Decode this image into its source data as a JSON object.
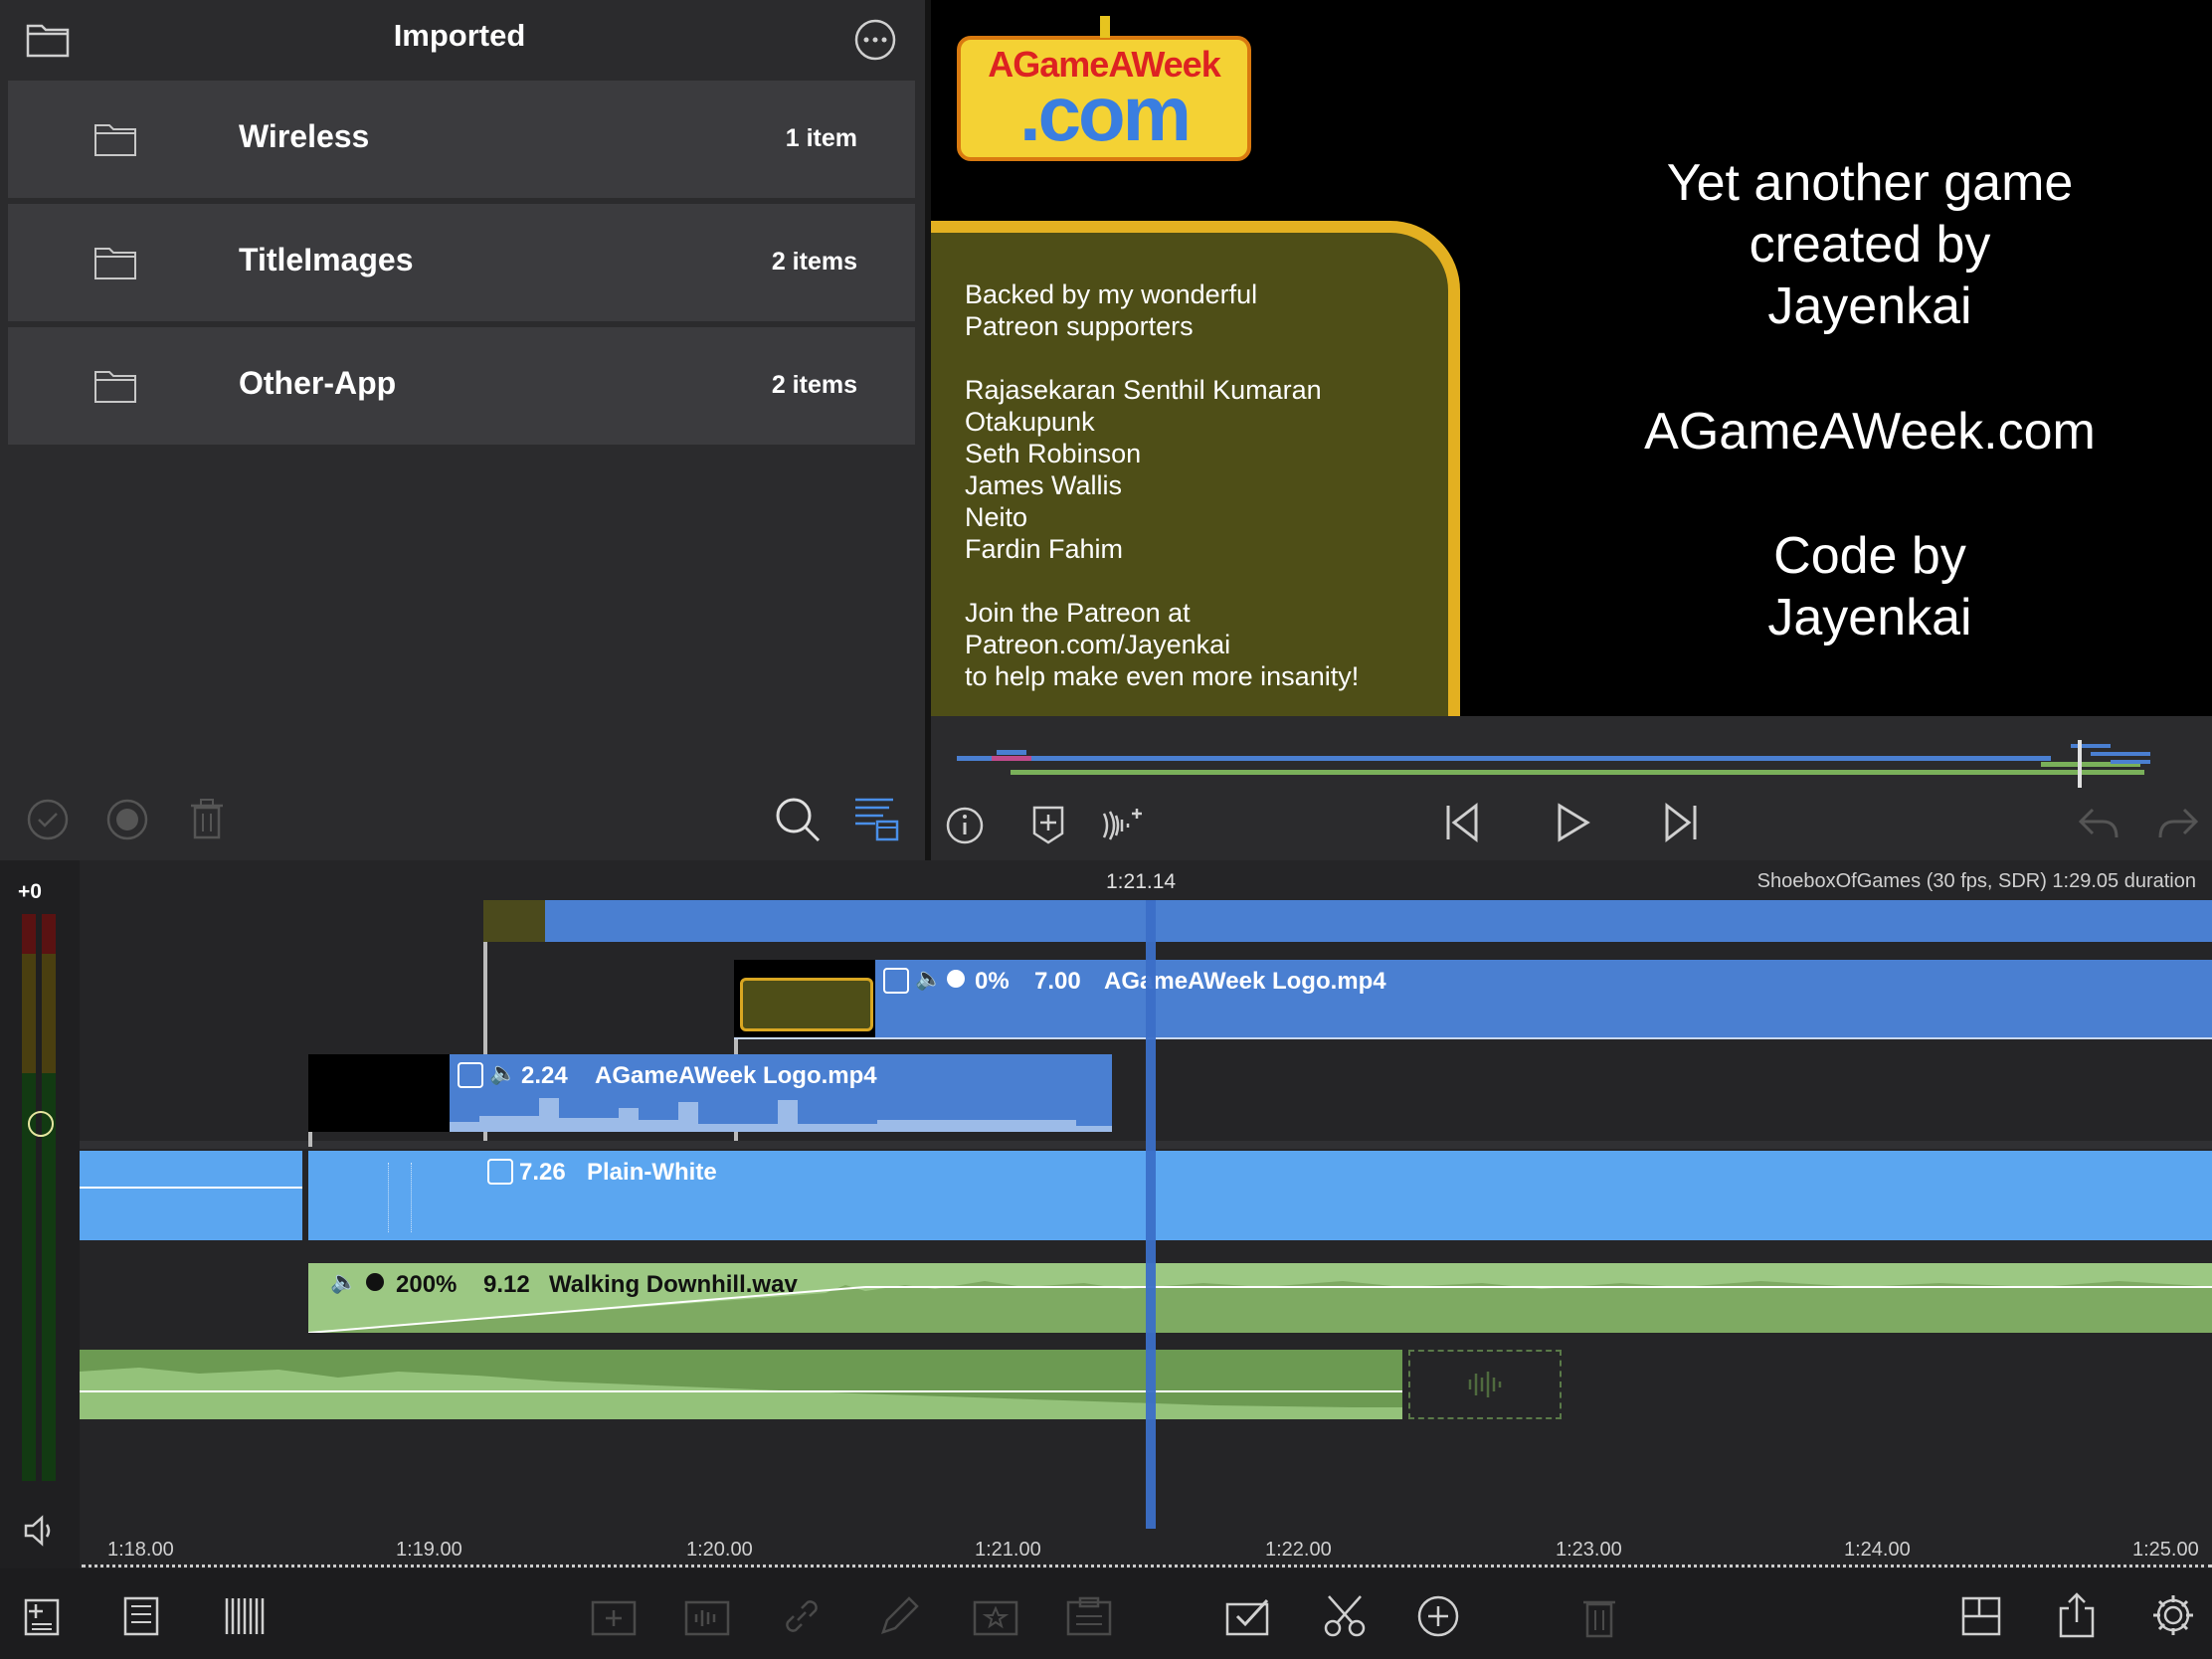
{
  "browser": {
    "title": "Imported",
    "folders": [
      {
        "name": "Wireless",
        "count": "1 item"
      },
      {
        "name": "TitleImages",
        "count": "2 items"
      },
      {
        "name": "Other-App",
        "count": "2 items"
      }
    ]
  },
  "viewer": {
    "logo_top": "AGameAWeek",
    "logo_bottom": ".com",
    "credits": "Backed by my wonderful\nPatreon supporters\n\nRajasekaran Senthil Kumaran\nOtakupunk\nSeth Robinson\nJames Wallis\nNeito\nFardin Fahim\n\nJoin the Patreon at\nPatreon.com/Jayenkai\nto help make even more insanity!",
    "right_line1": "Yet another game",
    "right_line2": "created by",
    "right_line3": "Jayenkai",
    "right_line4": "AGameAWeek.com",
    "right_line5": "Code by",
    "right_line6": "Jayenkai"
  },
  "timeline": {
    "volume_offset": "+0",
    "playhead_time": "1:21.14",
    "project_info": "ShoeboxOfGames (30 fps, SDR)  1:29.05 duration",
    "clips": {
      "logo_upper": {
        "pct": "0%",
        "dur": "7.00",
        "name": "AGameAWeek Logo.mp4"
      },
      "logo_lower": {
        "dur": "2.24",
        "name": "AGameAWeek Logo.mp4"
      },
      "plain_white": {
        "dur": "7.26",
        "name": "Plain-White"
      },
      "walking": {
        "pct": "200%",
        "dur": "9.12",
        "name": "Walking Downhill.wav"
      }
    },
    "ruler": [
      "1:18.00",
      "1:19.00",
      "1:20.00",
      "1:21.00",
      "1:22.00",
      "1:23.00",
      "1:24.00",
      "1:25.00"
    ]
  },
  "colors": {
    "clip_blue": "#4a7fd1",
    "clip_light_blue": "#5ba6f0",
    "audio_green": "#8ab86e",
    "accent": "#3b82f6"
  }
}
